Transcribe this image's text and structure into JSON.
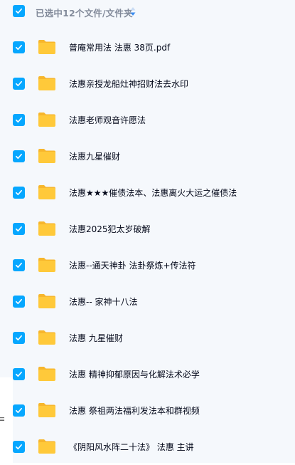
{
  "header": {
    "selection_label": "已选中12个文件/文件夹",
    "checkbox_checked": true
  },
  "colors": {
    "accent": "#06a7ff",
    "folder": "#ffc93a",
    "folder_tab": "#f7b62c",
    "row_background": "#f5f8fc",
    "text": "#03081a",
    "header_text": "#818999"
  },
  "files": [
    {
      "name": "普庵常用法 法惠 38页.pdf",
      "checked": true,
      "icon": "folder-icon"
    },
    {
      "name": "法惠亲授龙船灶神招财法去水印",
      "checked": true,
      "icon": "folder-icon"
    },
    {
      "name": "法惠老师观音许愿法",
      "checked": true,
      "icon": "folder-icon"
    },
    {
      "name": "法惠九星催财",
      "checked": true,
      "icon": "folder-icon"
    },
    {
      "name": "法惠★★★催债法本、法惠离火大运之催债法",
      "checked": true,
      "icon": "folder-icon"
    },
    {
      "name": "法惠2025犯太岁破解",
      "checked": true,
      "icon": "folder-icon"
    },
    {
      "name": "法惠--通天神卦 法卦祭炼+传法符",
      "checked": true,
      "icon": "folder-icon"
    },
    {
      "name": "法惠-- 家神十八法",
      "checked": true,
      "icon": "folder-icon"
    },
    {
      "name": "法惠 九星催财",
      "checked": true,
      "icon": "folder-icon"
    },
    {
      "name": "法惠 精神抑郁原因与化解法术必学",
      "checked": true,
      "icon": "folder-icon"
    },
    {
      "name": "法惠 祭祖两法福利发法本和群视频",
      "checked": true,
      "icon": "folder-icon"
    },
    {
      "name": "《阴阳风水阵二十法》 法惠 主讲",
      "checked": true,
      "icon": "folder-icon"
    }
  ]
}
